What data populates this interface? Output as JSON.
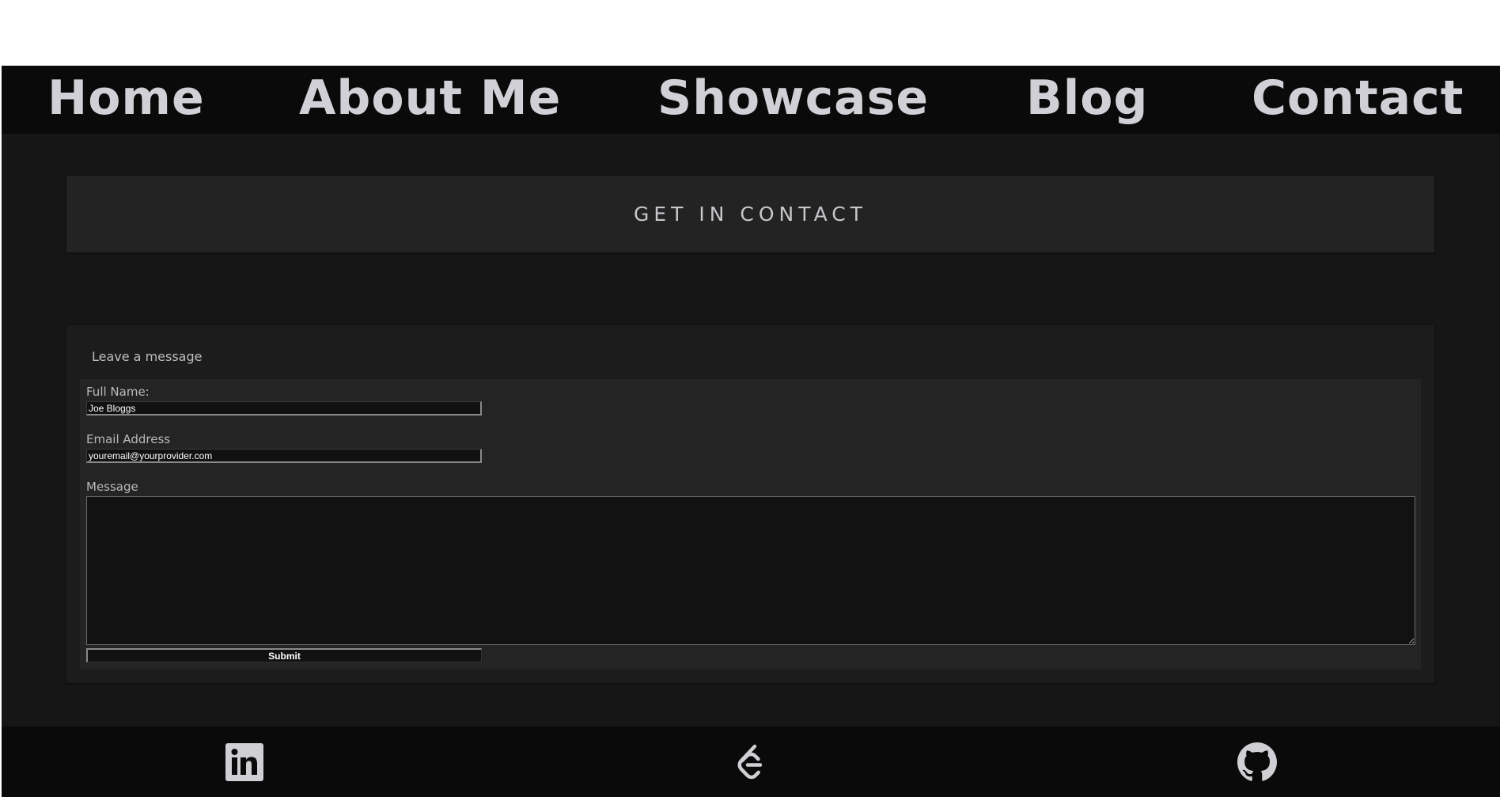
{
  "nav": {
    "items": [
      {
        "label": "Home"
      },
      {
        "label": "About Me"
      },
      {
        "label": "Showcase"
      },
      {
        "label": "Blog"
      },
      {
        "label": "Contact"
      }
    ]
  },
  "header": {
    "title": "GET IN CONTACT"
  },
  "form": {
    "card_title": "Leave a message",
    "full_name_label": "Full Name:",
    "full_name_value": "Joe Bloggs",
    "email_label": "Email Address",
    "email_value": "youremail@yourprovider.com",
    "message_label": "Message",
    "message_value": "",
    "submit_label": "Submit"
  },
  "footer": {
    "icons": [
      "linkedin-icon",
      "leetcode-icon",
      "github-icon"
    ]
  },
  "colors": {
    "page_bg": "#161616",
    "bar_bg": "#0a0a0a",
    "card_bg": "#232323",
    "text": "#d0d0d6"
  }
}
